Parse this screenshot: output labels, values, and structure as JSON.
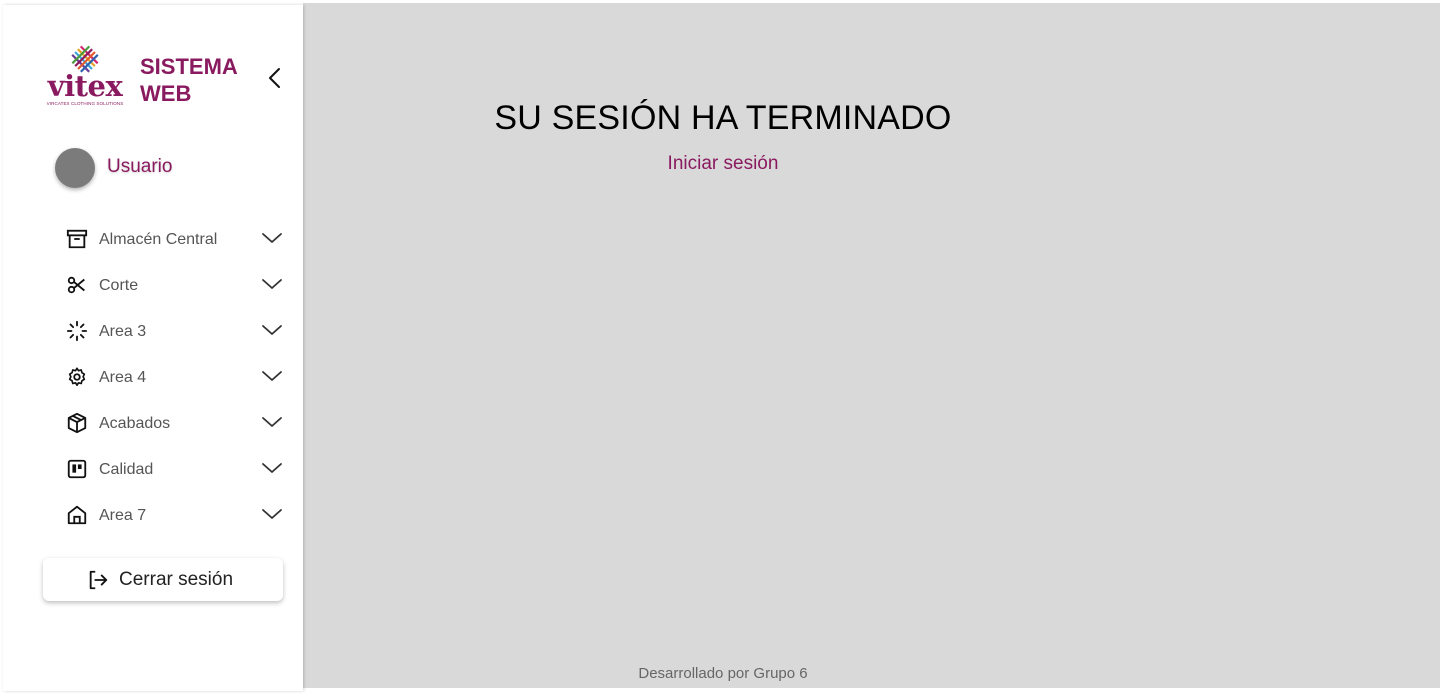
{
  "brand": {
    "logo_text": "vitex",
    "logo_subtitle": "VIRCATEX CLOTHING SOLUTIONS",
    "title_line1": "SISTEMA",
    "title_line2": "WEB",
    "collapse_icon": "chevron-left-icon"
  },
  "user": {
    "name": "Usuario"
  },
  "nav": {
    "items": [
      {
        "label": "Almacén Central",
        "icon": "archive-icon"
      },
      {
        "label": "Corte",
        "icon": "scissors-icon"
      },
      {
        "label": "Area 3",
        "icon": "loader-icon"
      },
      {
        "label": "Area 4",
        "icon": "gear-icon"
      },
      {
        "label": "Acabados",
        "icon": "package-icon"
      },
      {
        "label": "Calidad",
        "icon": "board-icon"
      },
      {
        "label": "Area 7",
        "icon": "home-icon"
      }
    ]
  },
  "logout": {
    "label": "Cerrar sesión",
    "icon": "logout-icon"
  },
  "main": {
    "title": "SU SESIÓN HA TERMINADO",
    "login_link": "Iniciar sesión",
    "footer": "Desarrollado por Grupo 6"
  },
  "colors": {
    "brand": "#8a1a5f",
    "main_bg": "#d9d9d9",
    "sidebar_bg": "#ffffff"
  }
}
